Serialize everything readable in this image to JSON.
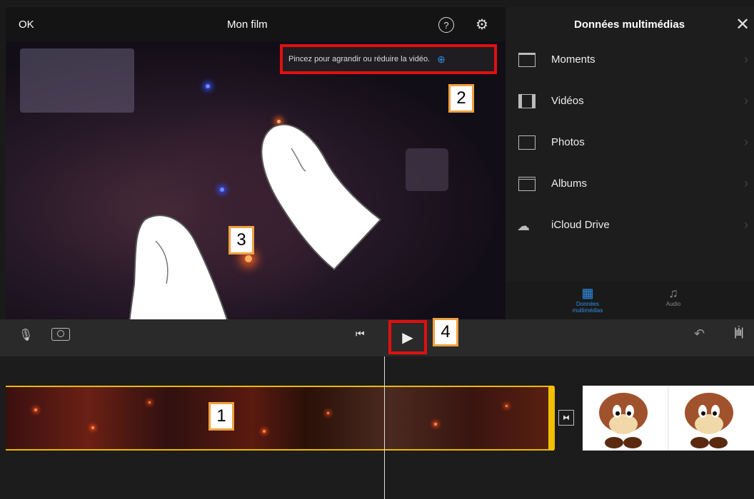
{
  "header": {
    "ok_label": "OK",
    "title": "Mon film",
    "help_icon": "help-icon",
    "settings_icon": "gear-icon"
  },
  "preview": {
    "hint_text": "Pincez pour agrandir ou réduire la vidéo.",
    "zoom_icon": "zoom-in-icon"
  },
  "media_panel": {
    "title": "Données multimédias",
    "close_icon": "close-icon",
    "items": [
      {
        "label": "Moments",
        "icon": "moments-icon"
      },
      {
        "label": "Vidéos",
        "icon": "video-icon"
      },
      {
        "label": "Photos",
        "icon": "photo-icon"
      },
      {
        "label": "Albums",
        "icon": "album-icon"
      },
      {
        "label": "iCloud Drive",
        "icon": "cloud-icon"
      }
    ],
    "tabs": [
      {
        "label": "Données multimédias",
        "icon": "media-icon",
        "active": true
      },
      {
        "label": "Audio",
        "icon": "music-icon",
        "active": false
      }
    ]
  },
  "toolbar": {
    "mic_icon": "microphone-icon",
    "camera_icon": "camera-icon",
    "rewind_icon": "skip-back-icon",
    "play_icon": "play-icon",
    "undo_icon": "undo-icon",
    "waveform_icon": "waveform-icon"
  },
  "annotations": {
    "tag1": "1",
    "tag2": "2",
    "tag3": "3",
    "tag4": "4"
  },
  "colors": {
    "highlight_red": "#e01010",
    "tag_border": "#f0a040",
    "clip_border": "#e8b800",
    "accent_blue": "#2f8fe8"
  }
}
